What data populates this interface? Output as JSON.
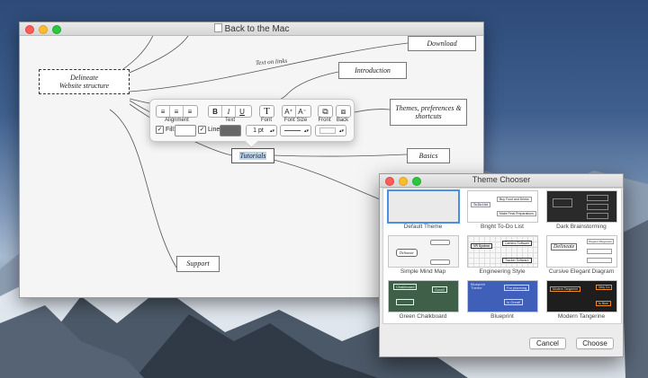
{
  "main_window": {
    "title": "Back to the Mac",
    "nodes": {
      "root": [
        "Delineate",
        "Website structure"
      ],
      "download": "Download",
      "introduction": "Introduction",
      "themes": "Themes, preferences & shortcuts",
      "tutorials": "Tutorials",
      "basics": "Basics",
      "support": "Support"
    },
    "link_label": "Text on links"
  },
  "format_popover": {
    "alignment_label": "Alignment",
    "text_label": "Text",
    "font_label": "Font",
    "font_size_label": "Font Size",
    "front_label": "Front",
    "back_label": "Back",
    "bold": "B",
    "italic": "I",
    "underline": "U",
    "font_glyph": "T",
    "font_up": "A⁺",
    "font_down": "A⁻",
    "fill_label": "Fill:",
    "fill_checked": true,
    "line_label": "Line:",
    "line_checked": true,
    "line_width": "1 pt",
    "fill_color": "#ffffff",
    "line_color": "#666666"
  },
  "theme_chooser": {
    "title": "Theme Chooser",
    "themes": [
      {
        "name": "Default Theme",
        "selected": true
      },
      {
        "name": "Bright To-Do List",
        "selected": false
      },
      {
        "name": "Dark Brainstorming",
        "selected": false
      },
      {
        "name": "Simple Mind Map",
        "selected": false
      },
      {
        "name": "Engineering Style",
        "selected": false
      },
      {
        "name": "Cursive Elegant Diagram",
        "selected": false
      },
      {
        "name": "Green Chalkboard",
        "selected": false
      },
      {
        "name": "Blueprint",
        "selected": false
      },
      {
        "name": "Modern Tangerine",
        "selected": false
      }
    ],
    "thumb_text": {
      "todo": [
        "To-Do List",
        "Buy Food and Drinks",
        "Make Final Preparations"
      ],
      "engineering": [
        "VR System",
        "Camera Software",
        "Tracker Software"
      ],
      "cursive": [
        "Delineate",
        "Elegant Diagrams"
      ],
      "mindmap": [
        "Delineate"
      ],
      "chalkboard": [
        "Chalkboard",
        "Good!"
      ],
      "blueprint": [
        "Blueprint Theme",
        "For planning",
        "Is Great!"
      ],
      "tangerine": [
        "Modern Tangerine",
        "Very Co",
        "Is Nice"
      ]
    },
    "cancel_label": "Cancel",
    "choose_label": "Choose"
  },
  "colors": {
    "selection": "#4a90e2",
    "close": "#fc5f57",
    "minimize": "#fdbc2e",
    "zoom": "#2ac840"
  }
}
